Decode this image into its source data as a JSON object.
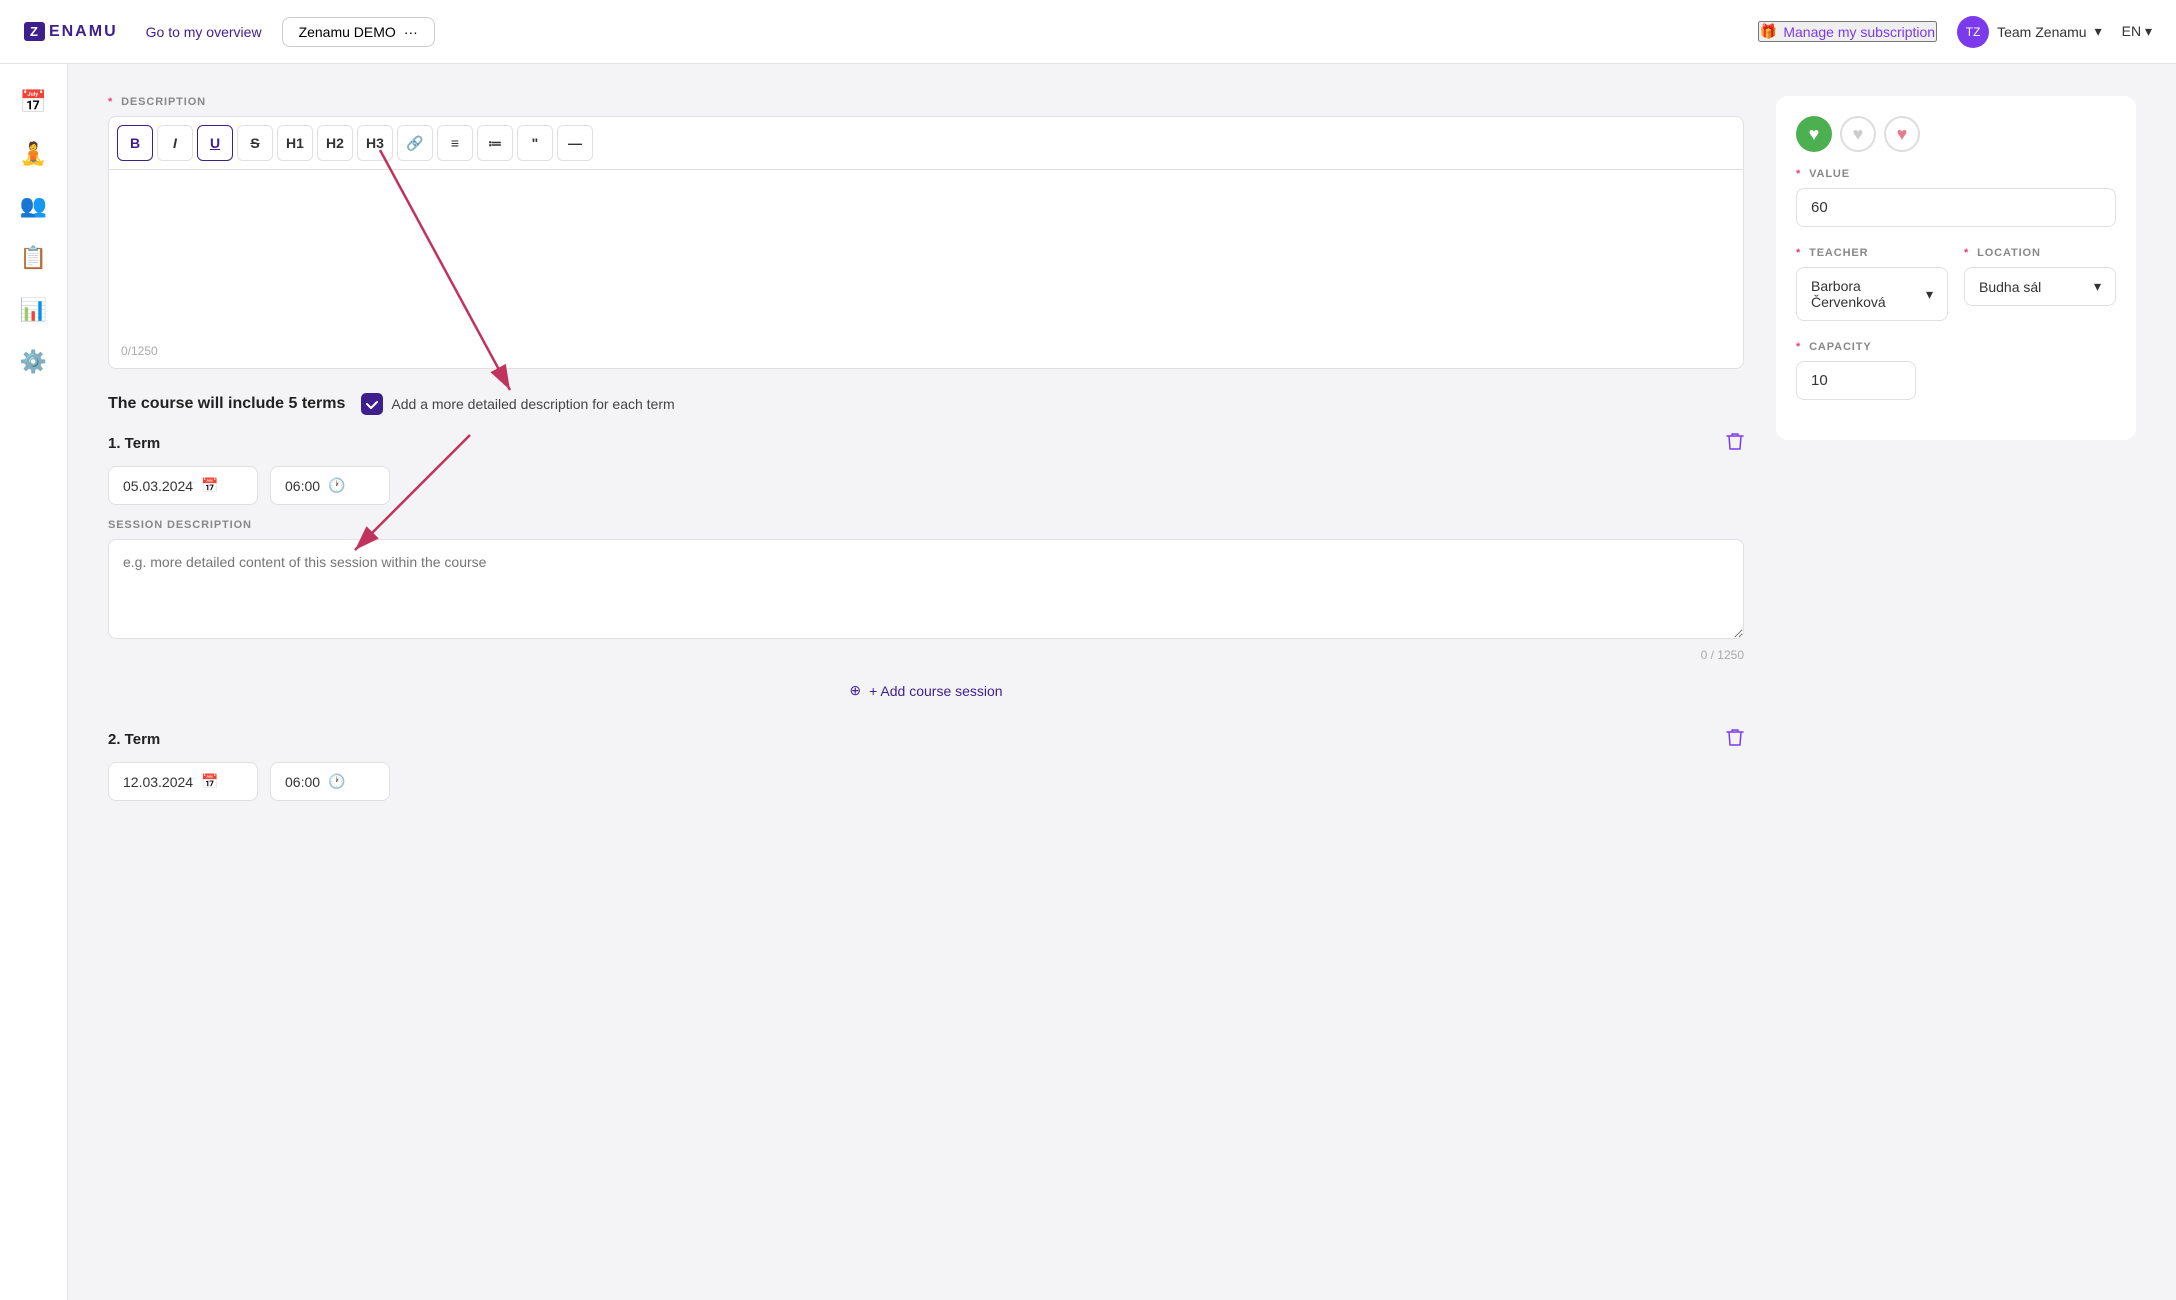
{
  "topnav": {
    "logo_text": "ZENAMU",
    "go_to_overview": "Go to my overview",
    "demo_label": "Zenamu DEMO",
    "more_icon": "···",
    "manage_subscription": "Manage my subscription",
    "team_label": "Team Zenamu",
    "lang": "EN"
  },
  "sidebar": {
    "items": [
      {
        "name": "calendar",
        "icon": "📅"
      },
      {
        "name": "yoga",
        "icon": "🧘"
      },
      {
        "name": "members",
        "icon": "👥"
      },
      {
        "name": "notes",
        "icon": "📋"
      },
      {
        "name": "analytics",
        "icon": "📊"
      },
      {
        "name": "settings",
        "icon": "⚙️"
      }
    ]
  },
  "editor": {
    "description_label": "DESCRIPTION",
    "toolbar_buttons": [
      "B",
      "I",
      "U",
      "S",
      "H1",
      "H2",
      "H3",
      "🔗",
      "≡",
      "≔",
      "\"",
      "—"
    ],
    "counter": "0/1250"
  },
  "course": {
    "terms_text": "The course will include 5 terms",
    "checkbox_label": "Add a more detailed description for each term",
    "checkbox_checked": true,
    "terms": [
      {
        "number": 1,
        "title": "1. Term",
        "date": "05.03.2024",
        "time": "06:00",
        "session_desc_label": "SESSION DESCRIPTION",
        "session_placeholder": "e.g. more detailed content of this session within the course",
        "session_counter": "0 / 1250",
        "add_session_label": "+ Add course session"
      },
      {
        "number": 2,
        "title": "2. Term",
        "date": "12.03.2024",
        "time": "06:00"
      }
    ]
  },
  "right_panel": {
    "value_label": "VALUE",
    "value": "60",
    "teacher_label": "TEACHER",
    "teacher_value": "Barbora Červenková",
    "location_label": "LOCATION",
    "location_value": "Budha sál",
    "capacity_label": "CAPACITY",
    "capacity_value": "10",
    "reaction_buttons": [
      {
        "name": "heart-green",
        "icon": "♥",
        "style": "green"
      },
      {
        "name": "heart-grey",
        "icon": "♥",
        "style": "grey-outline"
      },
      {
        "name": "heart-pink",
        "icon": "♥",
        "style": "pink-outline"
      }
    ]
  }
}
